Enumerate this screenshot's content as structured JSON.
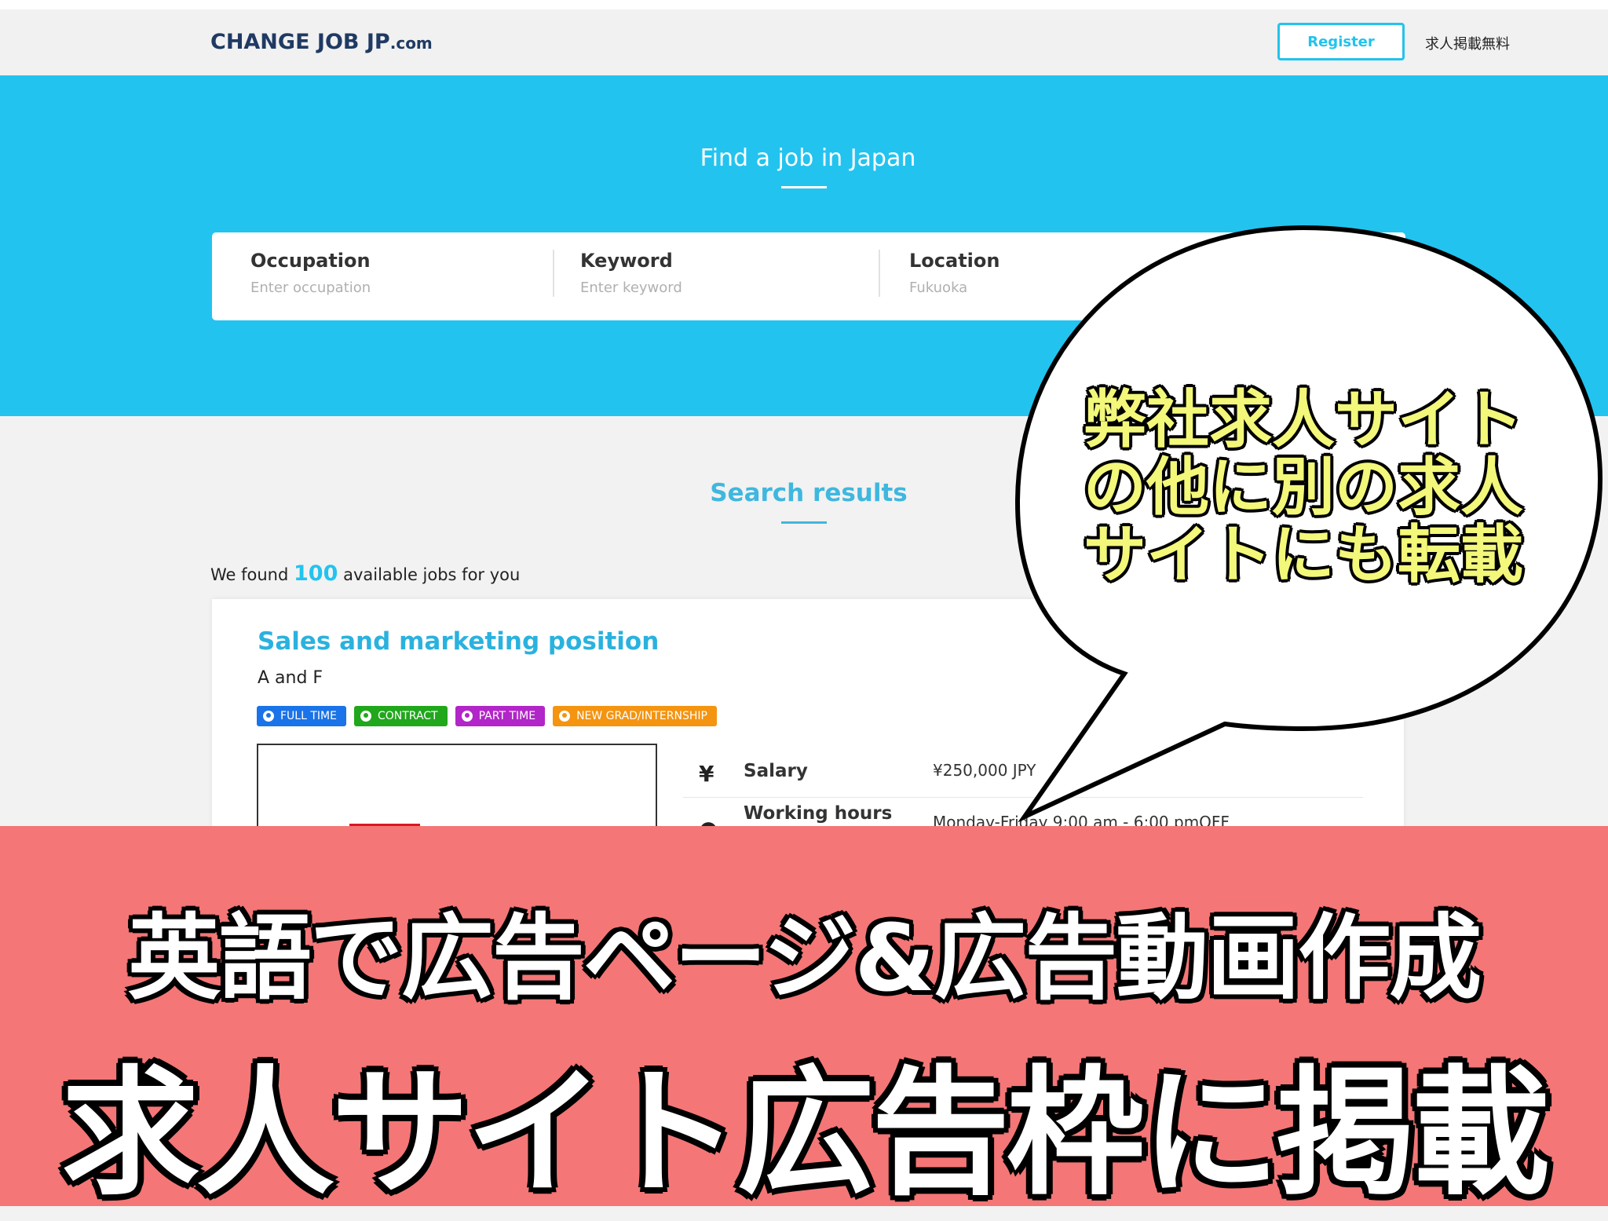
{
  "header": {
    "logo_main": "CHANGE JOB JP",
    "logo_suffix": ".com",
    "register_label": "Register",
    "free_post_label": "求人掲載無料"
  },
  "hero": {
    "title": "Find a job in Japan",
    "fields": [
      {
        "label": "Occupation",
        "placeholder": "Enter occupation"
      },
      {
        "label": "Keyword",
        "placeholder": "Enter keyword"
      },
      {
        "label": "Location",
        "placeholder": "Fukuoka"
      }
    ]
  },
  "results": {
    "title": "Search results",
    "found_prefix": "We found",
    "count": "100",
    "found_suffix": "available jobs for you"
  },
  "job": {
    "title": "Sales and marketing position",
    "company": "A and F",
    "tags": [
      {
        "label": "FULL TIME",
        "color": "#1a73e8"
      },
      {
        "label": "CONTRACT",
        "color": "#21a71c"
      },
      {
        "label": "PART TIME",
        "color": "#b225c8"
      },
      {
        "label": "NEW GRAD/INTERNSHIP",
        "color": "#f49410"
      }
    ],
    "salary_icon": "¥",
    "salary_label": "Salary",
    "salary_value": "¥250,000 JPY",
    "hours_label": "Working hours",
    "hours_value": "Monday-Friday 9:00 am - 6:00 pmOFF"
  },
  "bubble": {
    "line1": "弊社求人サイト",
    "line2": "の他に別の求人",
    "line3": "サイトにも転載"
  },
  "banner": {
    "line1": "英語で広告ページ&広告動画作成",
    "line2": "求人サイト広告枠に掲載"
  }
}
